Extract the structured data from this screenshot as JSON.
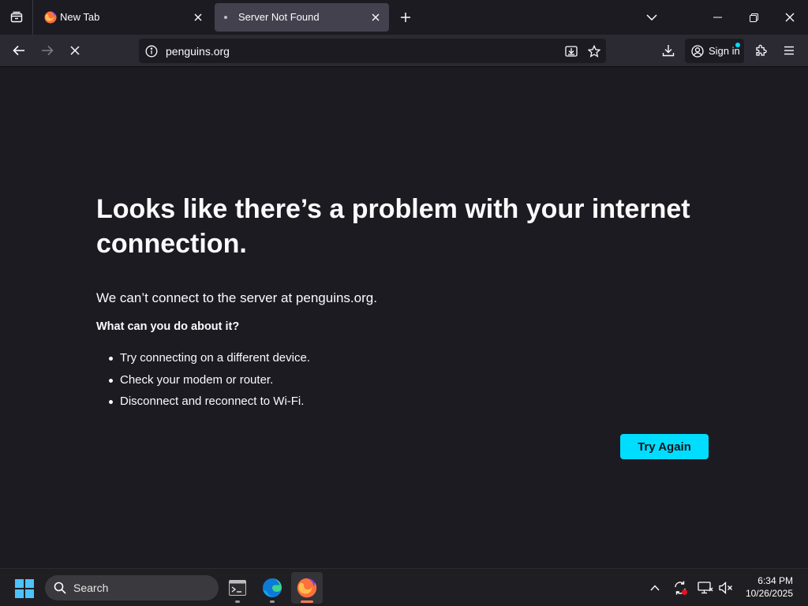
{
  "tabs": [
    {
      "title": "New Tab",
      "active": false
    },
    {
      "title": "Server Not Found",
      "active": true
    }
  ],
  "navbar": {
    "url": "penguins.org",
    "sign_in_label": "Sign in"
  },
  "error": {
    "title": "Looks like there’s a problem with your internet connection.",
    "description": "We can’t connect to the server at penguins.org.",
    "subheading": "What can you do about it?",
    "suggestions": [
      "Try connecting on a different device.",
      "Check your modem or router.",
      "Disconnect and reconnect to Wi-Fi."
    ],
    "button_label": "Try Again"
  },
  "taskbar": {
    "search_placeholder": "Search",
    "time": "6:34 PM",
    "date": "10/26/2025"
  },
  "colors": {
    "accent": "#00ddff",
    "page_background": "#1c1b22",
    "toolbar": "#2b2a33",
    "selected_tab": "#42414d"
  },
  "icons": {
    "tab_list": "tab-list-icon",
    "favicon": "firefox-icon",
    "loading": "loading-dot-icon",
    "close_tab": "close-icon",
    "new_tab": "plus-icon",
    "list_all_tabs": "chevron-down-icon",
    "back": "back-arrow-icon",
    "forward": "forward-arrow-icon",
    "stop": "stop-icon",
    "site_info": "info-icon",
    "page_save": "save-page-icon",
    "bookmark": "star-icon",
    "downloads": "download-icon",
    "account": "account-icon",
    "extensions": "puzzle-icon",
    "menu": "hamburger-menu-icon"
  }
}
